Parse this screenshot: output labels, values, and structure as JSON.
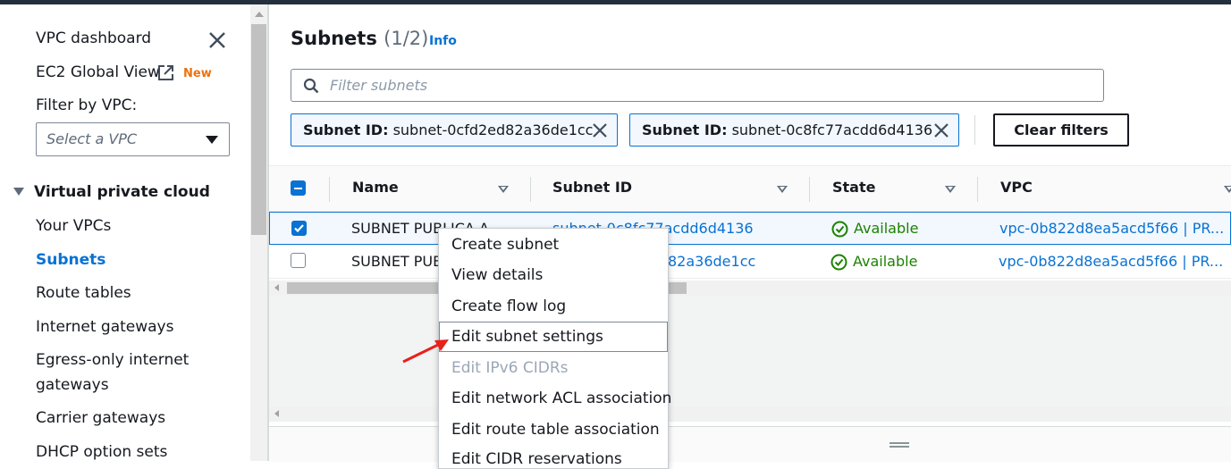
{
  "sidebar": {
    "dashboard": "VPC dashboard",
    "ec2_global": "EC2 Global View",
    "new_badge": "New",
    "filter_label": "Filter by VPC:",
    "select_placeholder": "Select a VPC",
    "section": "Virtual private cloud",
    "items": [
      {
        "label": "Your VPCs"
      },
      {
        "label": "Subnets"
      },
      {
        "label": "Route tables"
      },
      {
        "label": "Internet gateways"
      },
      {
        "label": "Egress-only internet"
      },
      {
        "label": "gateways"
      },
      {
        "label": "Carrier gateways"
      },
      {
        "label": "DHCP option sets"
      }
    ]
  },
  "main": {
    "title": "Subnets",
    "count": "(1/2)",
    "info": "Info",
    "search_placeholder": "Filter subnets",
    "tokens": [
      {
        "key": "Subnet ID:",
        "value": "subnet-0cfd2ed82a36de1cc"
      },
      {
        "key": "Subnet ID:",
        "value": "subnet-0c8fc77acdd6d4136"
      }
    ],
    "clear_filters": "Clear filters",
    "columns": [
      "Name",
      "Subnet ID",
      "State",
      "VPC"
    ],
    "rows": [
      {
        "name": "SUBNET PUBLICA A",
        "subnet_id": "subnet-0c8fc77acdd6d4136",
        "state": "Available",
        "vpc": "vpc-0b822d8ea5acd5f66 | PR...",
        "selected": true
      },
      {
        "name": "SUBNET PUB",
        "subnet_id": "82a36de1cc",
        "state": "Available",
        "vpc": "vpc-0b822d8ea5acd5f66 | PR...",
        "selected": false
      }
    ]
  },
  "context_menu": {
    "items": [
      {
        "label": "Create subnet",
        "enabled": true
      },
      {
        "label": "View details",
        "enabled": true
      },
      {
        "label": "Create flow log",
        "enabled": true
      },
      {
        "label": "Edit subnet settings",
        "enabled": true,
        "highlighted": true
      },
      {
        "label": "Edit IPv6 CIDRs",
        "enabled": false
      },
      {
        "label": "Edit network ACL association",
        "enabled": true
      },
      {
        "label": "Edit route table association",
        "enabled": true
      },
      {
        "label": "Edit CIDR reservations",
        "enabled": true
      }
    ]
  },
  "colors": {
    "accent": "#0972d3",
    "available": "#1d8102",
    "new_badge": "#ec7211",
    "annotation_arrow": "#e8201a"
  }
}
